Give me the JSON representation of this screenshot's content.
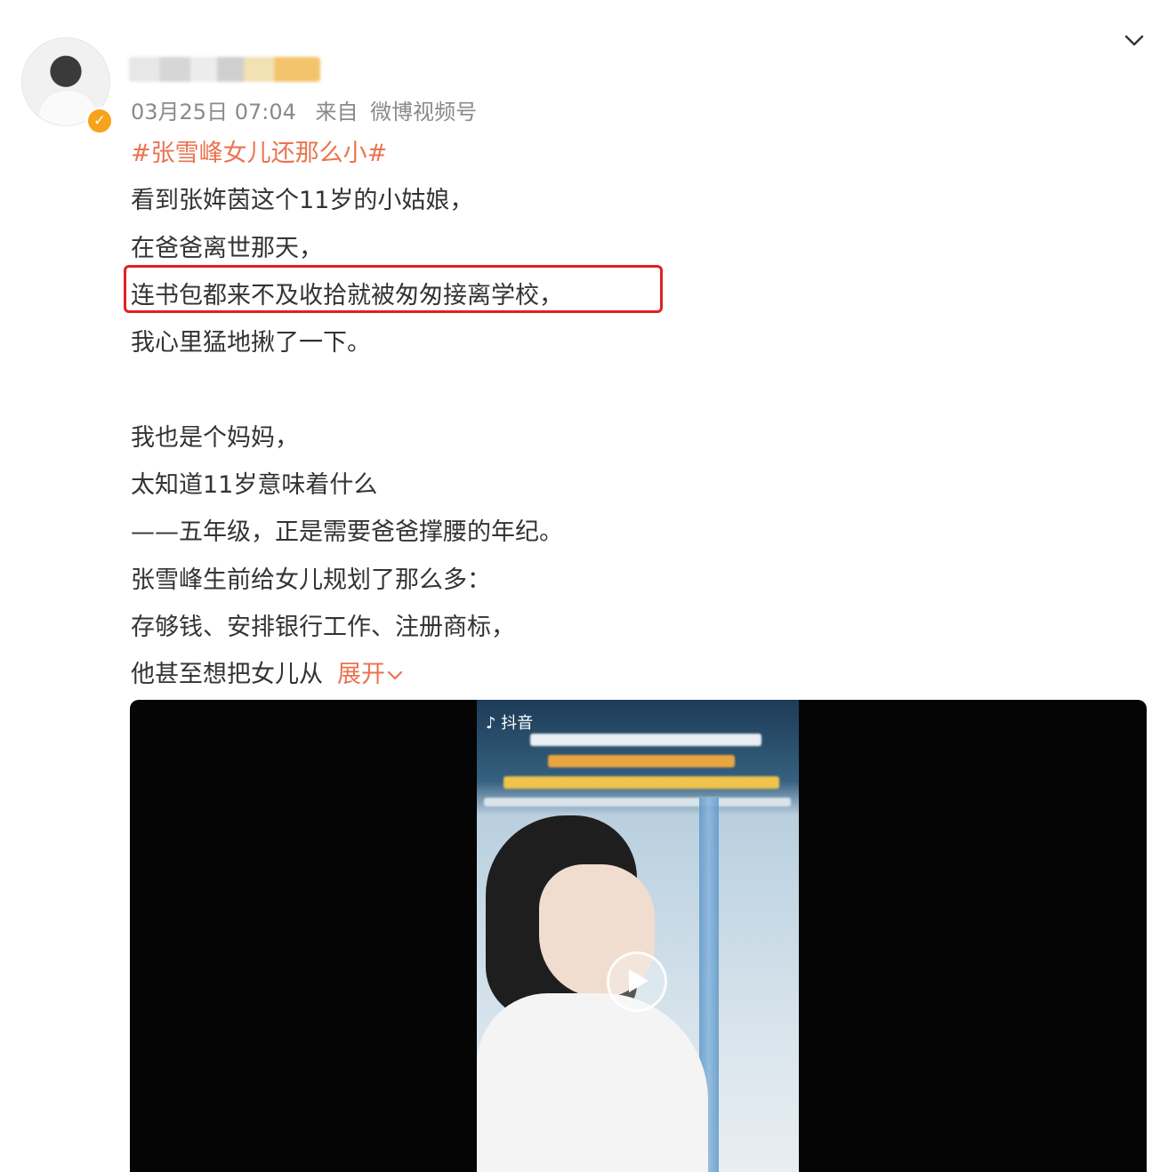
{
  "post": {
    "date": "03月25日 07:04",
    "source_prefix": "来自",
    "source": "微博视频号",
    "hashtag": "#张雪峰女儿还那么小#",
    "lines": [
      "看到张姩茵这个11岁的小姑娘，",
      "在爸爸离世那天，",
      "连书包都来不及收拾就被匆匆接离学校，",
      "我心里猛地揪了一下。",
      "",
      "我也是个妈妈，",
      "太知道11岁意味着什么",
      "——五年级，正是需要爸爸撑腰的年纪。",
      "张雪峰生前给女儿规划了那么多：",
      "存够钱、安排银行工作、注册商标，",
      "他甚至想把女儿从"
    ],
    "expand_label": "展开"
  },
  "video": {
    "platform_label": "抖音"
  },
  "icons": {
    "collapse": "chevron-down-icon",
    "verified": "verified-badge-icon",
    "play": "play-icon"
  },
  "colors": {
    "accent": "#eb7350",
    "highlight": "#e02020",
    "verified": "#f7a21b",
    "meta": "#8a8a8a",
    "text": "#333333"
  }
}
